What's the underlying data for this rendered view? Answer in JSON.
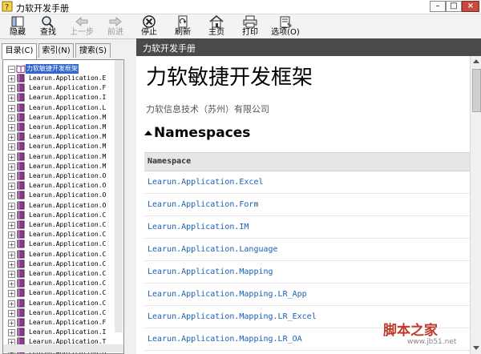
{
  "window": {
    "title": "力软开发手册"
  },
  "toolbar": {
    "buttons": [
      {
        "label": "隐藏",
        "icon": "hide-icon",
        "enabled": true
      },
      {
        "label": "查找",
        "icon": "find-icon",
        "enabled": true
      },
      {
        "label": "上一步",
        "icon": "back-arrow-icon",
        "enabled": false
      },
      {
        "label": "前进",
        "icon": "forward-arrow-icon",
        "enabled": false
      },
      {
        "label": "停止",
        "icon": "stop-icon",
        "enabled": true
      },
      {
        "label": "刷新",
        "icon": "refresh-icon",
        "enabled": true
      },
      {
        "label": "主页",
        "icon": "home-icon",
        "enabled": true
      },
      {
        "label": "打印",
        "icon": "print-icon",
        "enabled": true
      },
      {
        "label": "选项(O)",
        "icon": "options-icon",
        "enabled": true
      }
    ]
  },
  "nav_tabs": [
    {
      "label": "目录(C)",
      "active": true
    },
    {
      "label": "索引(N)",
      "active": false
    },
    {
      "label": "搜索(S)",
      "active": false
    }
  ],
  "tree": {
    "root": "力软敏捷开发框架",
    "items": [
      "Learun.Application.E",
      "Learun.Application.F",
      "Learun.Application.I",
      "Learun.Application.L",
      "Learun.Application.M",
      "Learun.Application.M",
      "Learun.Application.M",
      "Learun.Application.M",
      "Learun.Application.M",
      "Learun.Application.M",
      "Learun.Application.O",
      "Learun.Application.O",
      "Learun.Application.O",
      "Learun.Application.O",
      "Learun.Application.C",
      "Learun.Application.C",
      "Learun.Application.C",
      "Learun.Application.C",
      "Learun.Application.C",
      "Learun.Application.C",
      "Learun.Application.C",
      "Learun.Application.C",
      "Learun.Application.C",
      "Learun.Application.C",
      "Learun.Application.C",
      "Learun.Application.F",
      "Learun.Application.I",
      "Learun.Application.T",
      "Learun.Application.M",
      "Learun.Application.W"
    ]
  },
  "content": {
    "header": "力软开发手册",
    "title": "力软敏捷开发框架",
    "company": "力软信息技术（苏州）有限公司",
    "section_heading": "Namespaces",
    "table_header": "Namespace",
    "namespaces": [
      "Learun.Application.Excel",
      "Learun.Application.Form",
      "Learun.Application.IM",
      "Learun.Application.Language",
      "Learun.Application.Mapping",
      "Learun.Application.Mapping.LR_App",
      "Learun.Application.Mapping.LR_Excel",
      "Learun.Application.Mapping.LR_OA"
    ]
  },
  "watermark": {
    "text": "脚本之家",
    "url": "www.jb51.net"
  },
  "colors": {
    "header_bg": "#4a4a4a",
    "link": "#1a5fb4",
    "tree_selected": "#3366cc"
  }
}
